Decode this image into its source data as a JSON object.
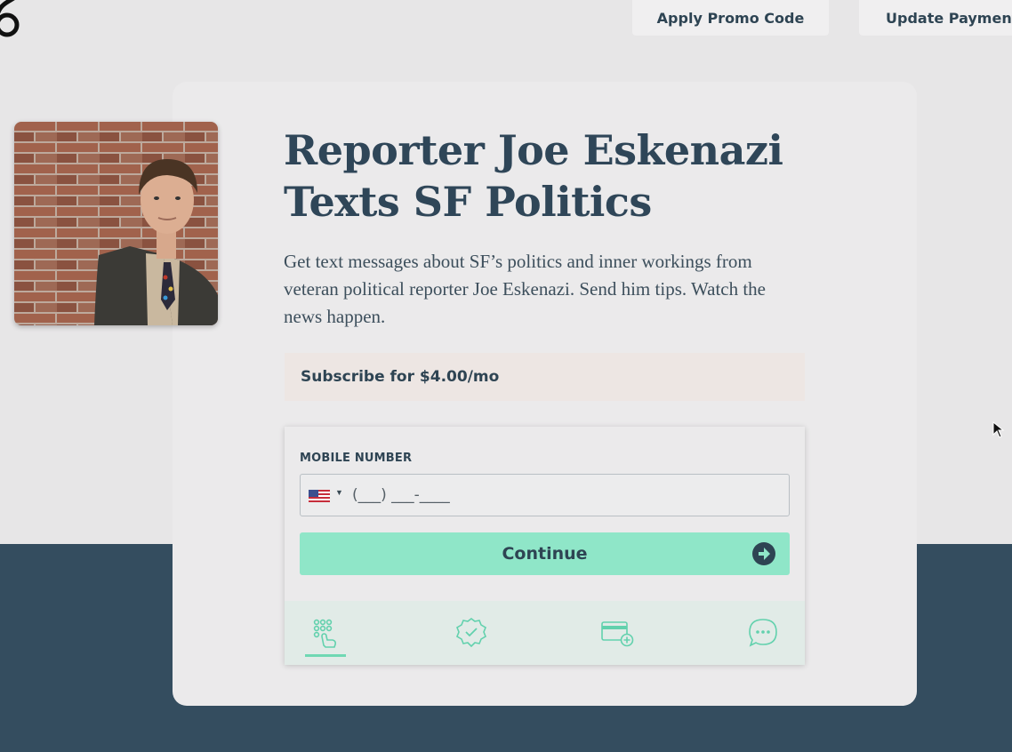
{
  "header": {
    "logo_icon": "brand-logo",
    "promo_label": "Apply Promo Code",
    "payment_label": "Update Payment"
  },
  "profile": {
    "photo_icon": "reporter-portrait"
  },
  "main": {
    "title_line1": "Reporter Joe Eskenazi",
    "title_line2": "Texts SF Politics",
    "description": "Get text messages about SF’s politics and inner workings from veteran political reporter Joe Eskenazi. Send him tips. Watch the news happen.",
    "subscribe_text": "Subscribe for $4.00/mo"
  },
  "form": {
    "mobile_label": "MOBILE NUMBER",
    "country_flag": "us-flag-icon",
    "phone_placeholder": "(___) ___-____",
    "phone_value": "",
    "continue_label": "Continue"
  },
  "steps": [
    {
      "icon": "keypad-touch-icon",
      "active": true
    },
    {
      "icon": "verified-badge-icon",
      "active": false
    },
    {
      "icon": "add-card-icon",
      "active": false
    },
    {
      "icon": "chat-bubble-icon",
      "active": false
    }
  ],
  "colors": {
    "navy": "#2e4453",
    "accent": "#8fe6c8",
    "band": "#344d5f",
    "banner": "#ede6e3",
    "step_icon": "#62d1ad"
  }
}
